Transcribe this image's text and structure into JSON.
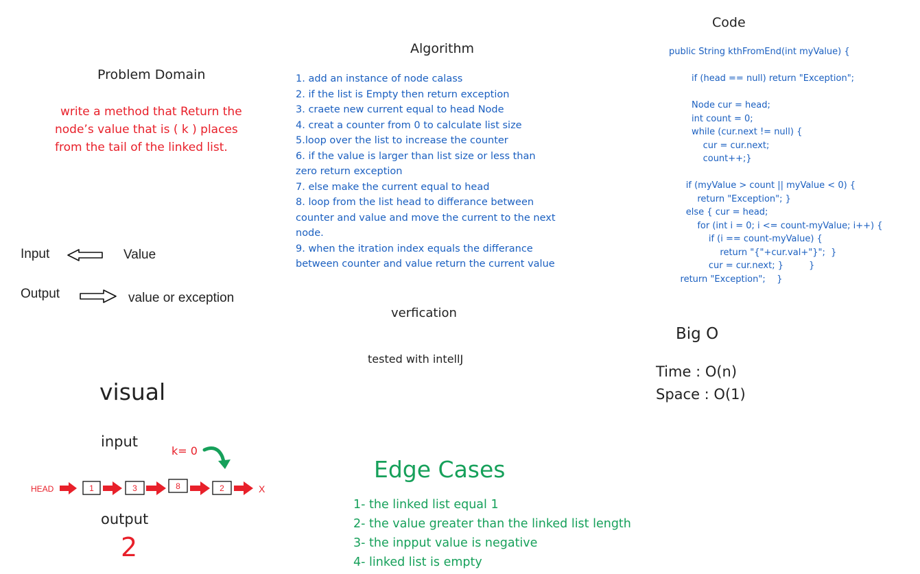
{
  "problem_domain": {
    "title": "Problem Domain",
    "lines": [
      "write a method that Return the",
      "node’s value that is ( k )  places",
      "from the tail of the linked list."
    ]
  },
  "algorithm": {
    "title": "Algorithm",
    "lines": [
      "1. add an instance of node calass",
      "2. if the list is Empty then return exception",
      "3.   craete new current equal to head Node",
      "4. creat a counter from 0 to calculate list size",
      "5.loop over the list to increase the counter",
      "6. if the value is larger than list size or less than",
      "zero return exception",
      "7. else make the current equal to head",
      "8. loop from the list head to differance between",
      "counter and value and move the current to the next",
      "node.",
      "9. when the itration index equals the differance",
      "between counter and value return the current value"
    ]
  },
  "code": {
    "title": "Code",
    "text": "public String kthFromEnd(int myValue) {\n\n        if (head == null) return \"Exception\";\n\n        Node cur = head;\n        int count = 0;\n        while (cur.next != null) {\n            cur = cur.next;\n            count++;}\n\n      if (myValue > count || myValue < 0) {\n          return \"Exception\"; }\n      else { cur = head;\n          for (int i = 0; i <= count-myValue; i++) {\n              if (i == count-myValue) {\n                  return \"{\"+cur.val+\"}\";  }\n              cur = cur.next; }         }\n    return \"Exception\";    }"
  },
  "io": {
    "input_label": "Input",
    "input_value": "Value",
    "output_label": "Output",
    "output_value": "value or exception"
  },
  "verification": {
    "title": "verfication",
    "text": "tested with intellJ"
  },
  "big_o": {
    "title": "Big O",
    "time": "Time : O(n)",
    "space": "Space : O(1)"
  },
  "visual": {
    "title": "visual",
    "input_label": "input",
    "output_label": "output",
    "k_label": "k= 0",
    "head_label": "HEAD",
    "nodes": [
      "1",
      "3",
      "8",
      "2"
    ],
    "end_label": "X",
    "result": "2"
  },
  "edge_cases": {
    "title": "Edge Cases",
    "items": [
      "1- the linked list equal 1",
      "2- the value greater than the linked list length",
      "3- the inpput value is negative",
      "4- linked list is empty"
    ]
  },
  "colors": {
    "red": "#e8202a",
    "blue": "#1a5fc0",
    "green": "#16a05a"
  }
}
